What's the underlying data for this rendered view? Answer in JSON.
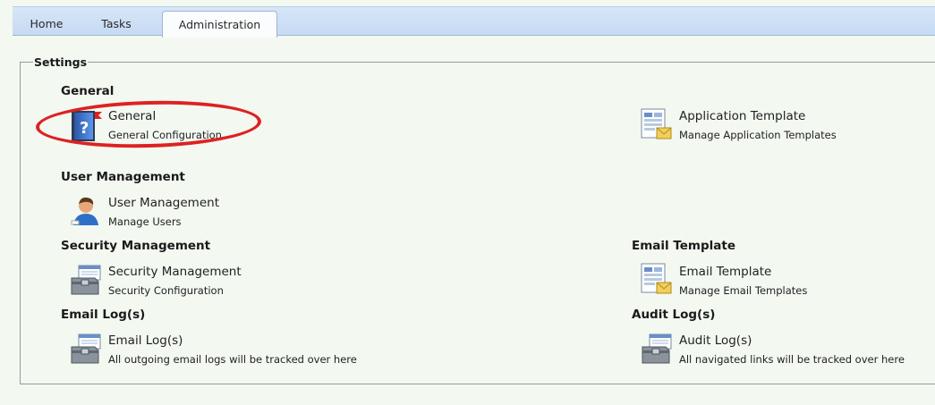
{
  "tabs": [
    {
      "label": "Home"
    },
    {
      "label": "Tasks"
    },
    {
      "label": "Administration"
    }
  ],
  "settings": {
    "legend": "Settings",
    "sections": {
      "general": {
        "heading": "General",
        "item": {
          "title": "General",
          "desc": "General Configuration",
          "icon": "help-book-icon"
        }
      },
      "application_template": {
        "item": {
          "title": "Application Template",
          "desc": "Manage Application Templates",
          "icon": "template-document-icon"
        }
      },
      "user_management": {
        "heading": "User Management",
        "item": {
          "title": "User Management",
          "desc": "Manage Users",
          "icon": "user-icon"
        }
      },
      "security_management": {
        "heading": "Security Management",
        "item": {
          "title": "Security Management",
          "desc": "Security Configuration",
          "icon": "toolbox-icon"
        }
      },
      "email_template": {
        "heading": "Email Template",
        "item": {
          "title": "Email Template",
          "desc": "Manage Email Templates",
          "icon": "template-document-icon"
        }
      },
      "email_logs": {
        "heading": "Email Log(s)",
        "item": {
          "title": "Email Log(s)",
          "desc": "All outgoing email logs will be tracked over here",
          "icon": "toolbox-icon"
        }
      },
      "audit_logs": {
        "heading": "Audit Log(s)",
        "item": {
          "title": "Audit Log(s)",
          "desc": "All navigated links will be tracked over here",
          "icon": "toolbox-icon"
        }
      }
    }
  },
  "colors": {
    "background": "#f3f8f1",
    "tab_bar": "#c6daf3",
    "highlight": "#dd2222"
  }
}
